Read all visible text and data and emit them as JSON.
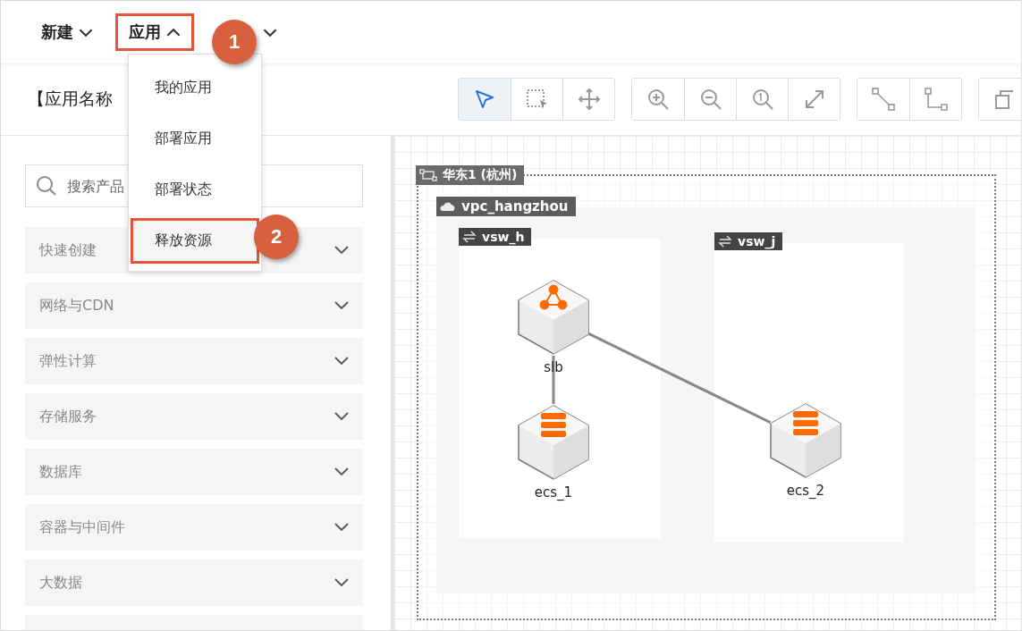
{
  "menubar": [
    {
      "label": "新建",
      "expanded": false,
      "highlighted": false
    },
    {
      "label": "应用",
      "expanded": true,
      "highlighted": true,
      "step": "1"
    },
    {
      "expanded": false,
      "highlighted": false
    }
  ],
  "dropdown": [
    {
      "label": "我的应用",
      "selected": false
    },
    {
      "label": "部署应用",
      "selected": false
    },
    {
      "label": "部署状态",
      "selected": false
    },
    {
      "label": "释放资源",
      "selected": true,
      "step": "2"
    }
  ],
  "app_title": "【应用名称",
  "toolbar": [
    [
      {
        "kind": "pointer",
        "selected": true
      },
      {
        "kind": "marquee",
        "selected": false
      },
      {
        "kind": "move",
        "selected": false
      }
    ],
    [
      {
        "kind": "zoom-in",
        "selected": false
      },
      {
        "kind": "zoom-out",
        "selected": false
      },
      {
        "kind": "zoom-actual",
        "selected": false
      },
      {
        "kind": "fit",
        "selected": false
      }
    ],
    [
      {
        "kind": "straight",
        "selected": false
      },
      {
        "kind": "elbow",
        "selected": false
      }
    ],
    [
      {
        "kind": "copy",
        "selected": false
      }
    ]
  ],
  "search": {
    "placeholder": "搜索产品"
  },
  "categories": [
    {
      "label": "快速创建",
      "expanded": false
    },
    {
      "label": "网络与CDN",
      "expanded": false
    },
    {
      "label": "弹性计算",
      "expanded": false
    },
    {
      "label": "存储服务",
      "expanded": false
    },
    {
      "label": "数据库",
      "expanded": false
    },
    {
      "label": "容器与中间件",
      "expanded": false
    },
    {
      "label": "大数据",
      "expanded": false
    }
  ],
  "diagram": {
    "region": "华东1 (杭州)",
    "vpc": "vpc_hangzhou",
    "vswitches": [
      {
        "name": "vsw_h"
      },
      {
        "name": "vsw_j"
      }
    ],
    "nodes": [
      {
        "name": "slb",
        "kind": "slb"
      },
      {
        "name": "ecs_1",
        "kind": "ecs"
      },
      {
        "name": "ecs_2",
        "kind": "ecs"
      }
    ]
  }
}
